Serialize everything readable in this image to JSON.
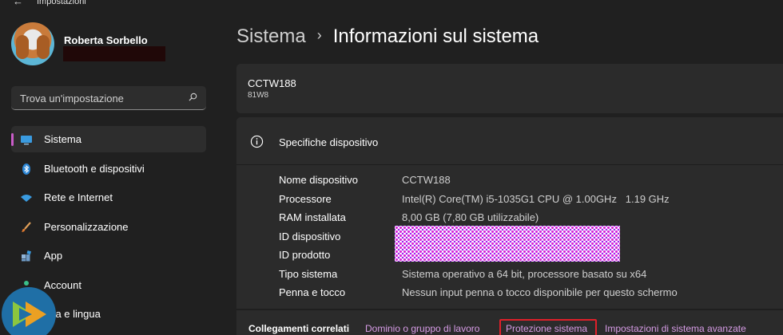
{
  "window": {
    "title": "Impostazioni"
  },
  "profile": {
    "name": "Roberta Sorbello"
  },
  "search": {
    "placeholder": "Trova un'impostazione"
  },
  "sidebar": {
    "items": [
      {
        "label": "Sistema",
        "icon": "monitor-icon",
        "active": true
      },
      {
        "label": "Bluetooth e dispositivi",
        "icon": "bluetooth-icon"
      },
      {
        "label": "Rete e Internet",
        "icon": "wifi-icon"
      },
      {
        "label": "Personalizzazione",
        "icon": "brush-icon"
      },
      {
        "label": "App",
        "icon": "apps-icon"
      },
      {
        "label": "Account",
        "icon": "person-icon"
      },
      {
        "label": "Ora e lingua",
        "icon": "clock-globe-icon"
      }
    ]
  },
  "breadcrumb": {
    "parent": "Sistema",
    "current": "Informazioni sul sistema"
  },
  "device": {
    "name": "CCTW188",
    "model": "81W8"
  },
  "specs": {
    "title": "Specifiche dispositivo",
    "rows": [
      {
        "label": "Nome dispositivo",
        "value": "CCTW188"
      },
      {
        "label": "Processore",
        "value": "Intel(R) Core(TM) i5-1035G1 CPU @ 1.00GHz   1.19 GHz"
      },
      {
        "label": "RAM installata",
        "value": "8,00 GB (7,80 GB utilizzabile)"
      },
      {
        "label": "ID dispositivo",
        "value": ""
      },
      {
        "label": "ID prodotto",
        "value": ""
      },
      {
        "label": "Tipo sistema",
        "value": "Sistema operativo a 64 bit, processore basato su x64"
      },
      {
        "label": "Penna e tocco",
        "value": "Nessun input penna o tocco disponibile per questo schermo"
      }
    ]
  },
  "related": {
    "label": "Collegamenti correlati",
    "links": [
      "Dominio o gruppo di lavoro",
      "Protezione sistema",
      "Impostazioni di sistema avanzate"
    ]
  },
  "colors": {
    "background": "#202020",
    "card": "#2b2b2b",
    "accent": "#c95cc8",
    "link": "#d79ce6",
    "highlight": "#e0202a"
  }
}
